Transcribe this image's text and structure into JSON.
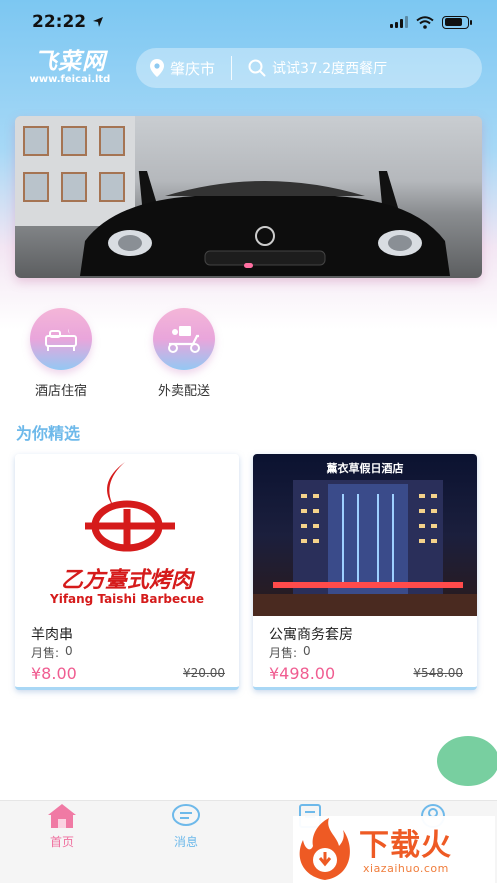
{
  "status_bar": {
    "time": "22:22"
  },
  "header": {
    "logo_text": "飞菜网",
    "logo_sub": "www.feicai.ltd",
    "location": "肇庆市",
    "search_placeholder": "试试37.2度西餐厅"
  },
  "categories": [
    {
      "label": "酒店住宿",
      "icon": "bed-icon"
    },
    {
      "label": "外卖配送",
      "icon": "delivery-scooter-icon"
    }
  ],
  "section_title": "为你精选",
  "products": [
    {
      "name": "羊肉串",
      "sales_label": "月售:",
      "sales": "0",
      "price": "¥8.00",
      "original_price": "¥20.00",
      "image_text": "乙方臺式烤肉",
      "image_subtext": "Yifang Taishi Barbecue"
    },
    {
      "name": "公寓商务套房",
      "sales_label": "月售:",
      "sales": "0",
      "price": "¥498.00",
      "original_price": "¥548.00",
      "image_text": "薰衣草假日酒店"
    }
  ],
  "tabbar": [
    {
      "label": "首页",
      "icon": "home-icon",
      "active": true
    },
    {
      "label": "消息",
      "icon": "message-icon",
      "active": false
    },
    {
      "label": "",
      "icon": "order-icon",
      "active": false
    },
    {
      "label": "",
      "icon": "user-icon",
      "active": false
    }
  ],
  "watermark": {
    "title": "下载火",
    "url": "xiazaihuo.com"
  },
  "colors": {
    "accent_pink": "#f05d91",
    "accent_blue": "#6eb9ea",
    "float_green": "#78cfa0"
  }
}
